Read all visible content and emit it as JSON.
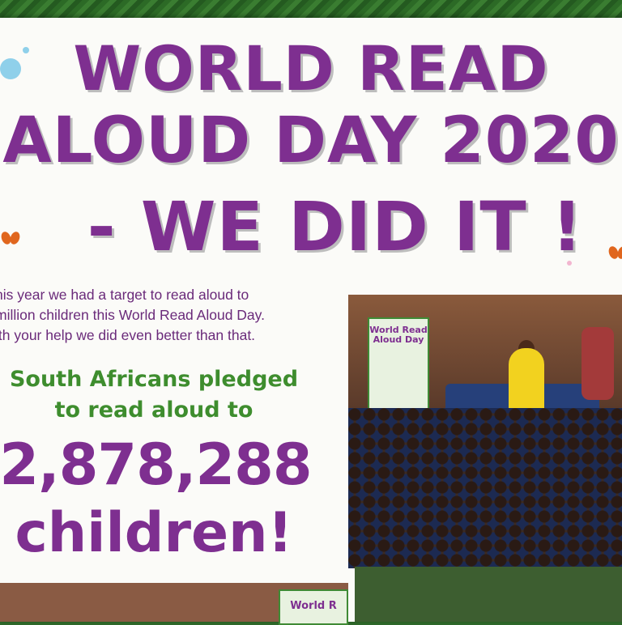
{
  "headline": {
    "line1": "WORLD READ",
    "line2": "ALOUD DAY 2020",
    "line3": "- WE DID IT !"
  },
  "intro": {
    "line1": "his year we had a target to read aloud to",
    "line2": "million children this World Read Aloud Day.",
    "line3": "ith your help we did even better than that."
  },
  "pledge": {
    "line1": "South Africans pledged",
    "line2": "to read aloud to"
  },
  "count": {
    "number": "2,878,288",
    "label": "children!"
  },
  "photo_banner": {
    "title": "World Read Aloud Day"
  },
  "bottom_banner": {
    "title": "World R"
  },
  "colors": {
    "purple": "#7e2f90",
    "green": "#3e8d2e",
    "background": "#fbfbf8"
  }
}
